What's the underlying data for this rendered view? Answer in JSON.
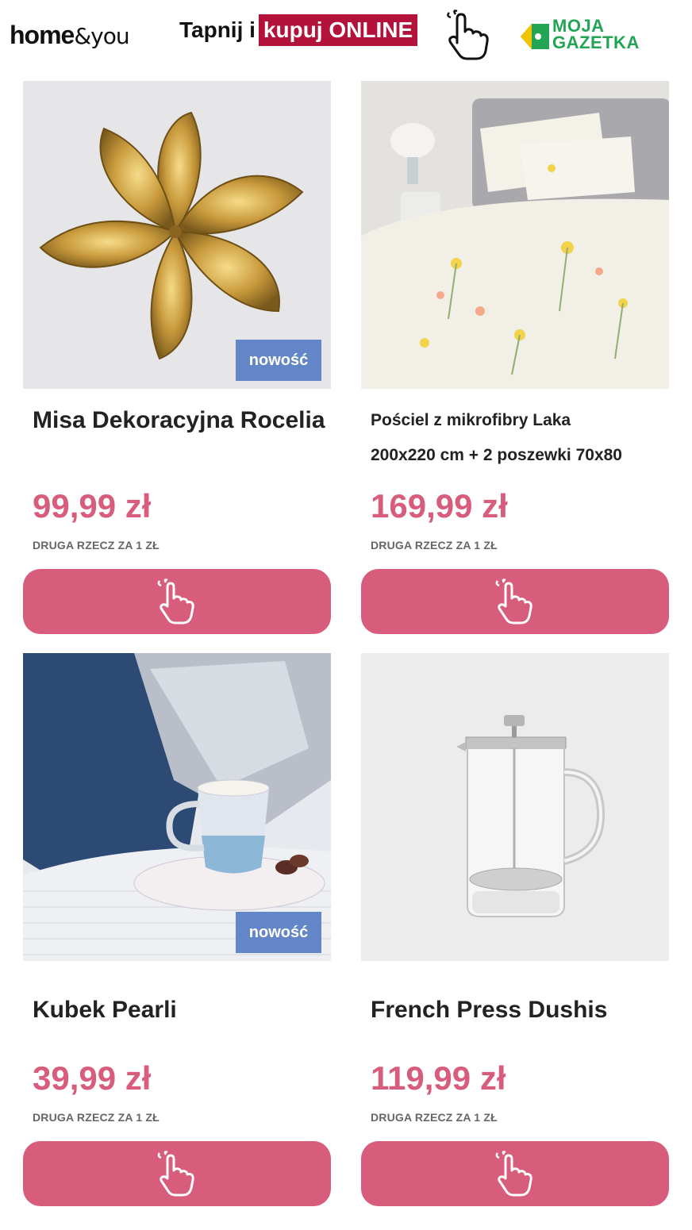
{
  "header": {
    "logo_bold": "home",
    "logo_light": "&you",
    "cta_plain": "Tapnij i",
    "cta_highlight": "kupuj ONLINE",
    "gazetka_line1": "MOJA",
    "gazetka_line2": "GAZETKA"
  },
  "colors": {
    "accent_pink": "#d85c7c",
    "badge_blue": "#6386c9",
    "cta_red": "#b3123a",
    "gazetka_green": "#23a455"
  },
  "products": [
    {
      "title": "Misa Dekoracyjna Rocelia",
      "price": "99,99 zł",
      "note": "DRUGA RZECZ ZA 1 ZŁ",
      "badge": "nowość"
    },
    {
      "title_line1": "Pościel z mikrofibry Laka",
      "title_line2": "200x220 cm + 2 poszewki 70x80",
      "price": "169,99 zł",
      "note": "DRUGA RZECZ ZA 1 ZŁ"
    },
    {
      "title": "Kubek Pearli",
      "price": "39,99 zł",
      "note": "DRUGA RZECZ ZA 1 ZŁ",
      "badge": "nowość"
    },
    {
      "title": "French Press Dushis",
      "price": "119,99 zł",
      "note": "DRUGA RZECZ ZA 1 ZŁ"
    }
  ],
  "icons": {
    "buy_button": "hand-pointer-icon"
  }
}
